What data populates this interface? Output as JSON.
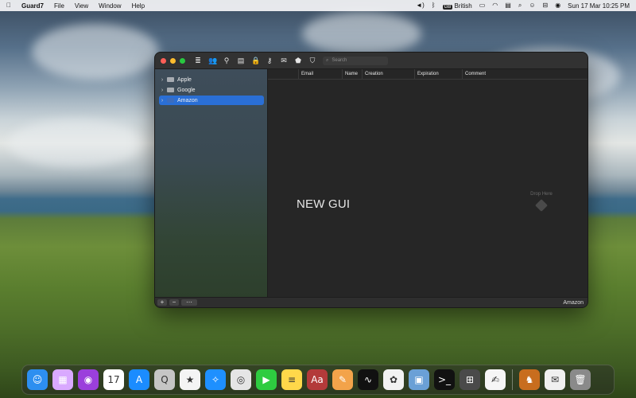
{
  "menubar": {
    "app_name": "Guard7",
    "menus": [
      "File",
      "View",
      "Window",
      "Help"
    ],
    "input_source": "British",
    "datetime": "Sun 17 Mar  10:25 PM"
  },
  "window": {
    "search_placeholder": "Search",
    "sidebar_items": [
      {
        "label": "Apple",
        "selected": false
      },
      {
        "label": "Google",
        "selected": false
      },
      {
        "label": "Amazon",
        "selected": true
      }
    ],
    "columns": [
      "",
      "Email",
      "Name",
      "Creation",
      "Expiration",
      "Comment"
    ],
    "center_text": "NEW GUI",
    "drop_text": "Drop Here",
    "status_right": "Amazon",
    "bottom_buttons": [
      "+",
      "−",
      "⋯"
    ]
  },
  "dock": {
    "apps": [
      {
        "name": "Finder",
        "color": "#2d8ff0",
        "icon": "finder-icon",
        "glyph": "☺"
      },
      {
        "name": "Launchpad",
        "color": "#d9a9ff",
        "icon": "launchpad-icon",
        "glyph": "▦"
      },
      {
        "name": "Podcasts",
        "color": "#9b3fdc",
        "icon": "podcasts-icon",
        "glyph": "◉"
      },
      {
        "name": "Calendar",
        "color": "#ffffff",
        "icon": "calendar-icon",
        "glyph": "17"
      },
      {
        "name": "App Store",
        "color": "#1b8cff",
        "icon": "appstore-icon",
        "glyph": "A"
      },
      {
        "name": "QuickTime",
        "color": "#c5c5c5",
        "icon": "quicktime-icon",
        "glyph": "Q"
      },
      {
        "name": "iMovie",
        "color": "#f4f4f4",
        "icon": "imovie-icon",
        "glyph": "★"
      },
      {
        "name": "Safari",
        "color": "#1e90ff",
        "icon": "safari-icon",
        "glyph": "✧"
      },
      {
        "name": "Chrome",
        "color": "#e5e5e5",
        "icon": "chrome-icon",
        "glyph": "◎"
      },
      {
        "name": "FaceTime",
        "color": "#2ecc40",
        "icon": "facetime-icon",
        "glyph": "▶"
      },
      {
        "name": "Notes",
        "color": "#ffd84a",
        "icon": "notes-icon",
        "glyph": "≡"
      },
      {
        "name": "Dictionary",
        "color": "#b33a3a",
        "icon": "dictionary-icon",
        "glyph": "Aa"
      },
      {
        "name": "Pages",
        "color": "#f3a34a",
        "icon": "pages-icon",
        "glyph": "✎"
      },
      {
        "name": "Activity Monitor",
        "color": "#111111",
        "icon": "activity-monitor-icon",
        "glyph": "∿"
      },
      {
        "name": "Photos",
        "color": "#f2f2f2",
        "icon": "photos-icon",
        "glyph": "✿"
      },
      {
        "name": "Preview",
        "color": "#6aa0d6",
        "icon": "preview-icon",
        "glyph": "▣"
      },
      {
        "name": "Terminal",
        "color": "#111111",
        "icon": "terminal-icon",
        "glyph": ">_"
      },
      {
        "name": "Calculator",
        "color": "#4a4a4a",
        "icon": "calculator-icon",
        "glyph": "⊞"
      },
      {
        "name": "TextEdit",
        "color": "#f6f6f6",
        "icon": "textedit-icon",
        "glyph": "✍"
      },
      {
        "name": "Guard7",
        "color": "#c86d1e",
        "icon": "guard7-icon",
        "glyph": "♞"
      },
      {
        "name": "Mail Draft",
        "color": "#f0f0f0",
        "icon": "document-icon",
        "glyph": "✉"
      },
      {
        "name": "Trash",
        "color": "#8a8a8a",
        "icon": "trash-icon",
        "glyph": "🗑"
      }
    ]
  }
}
